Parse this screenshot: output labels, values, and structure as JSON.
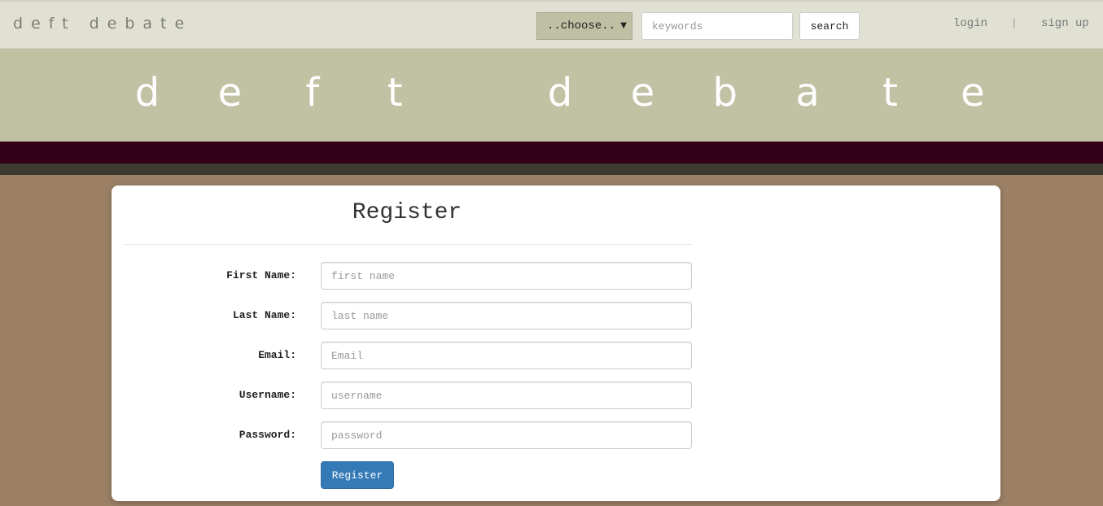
{
  "nav": {
    "brand": "deft debate",
    "category_select": "..choose..",
    "search_placeholder": "keywords",
    "search_label": "search",
    "login_label": "login",
    "separator": "|",
    "signup_label": "sign up"
  },
  "banner": {
    "letters": [
      "d",
      "e",
      "f",
      "t",
      "",
      "d",
      "e",
      "b",
      "a",
      "t",
      "e"
    ]
  },
  "form": {
    "title": "Register",
    "fields": [
      {
        "label": "First Name:",
        "placeholder": "first name"
      },
      {
        "label": "Last Name:",
        "placeholder": "last name"
      },
      {
        "label": "Email:",
        "placeholder": "Email"
      },
      {
        "label": "Username:",
        "placeholder": "username"
      },
      {
        "label": "Password:",
        "placeholder": "password"
      }
    ],
    "submit_label": "Register"
  },
  "colors": {
    "navbar_bg": "#e0e1d3",
    "banner_bg": "#c1c1a4",
    "stripe_dark": "#33001a",
    "stripe_olive": "#3b3b2e",
    "page_bg": "#9b8066",
    "primary_button": "#337ab7"
  }
}
